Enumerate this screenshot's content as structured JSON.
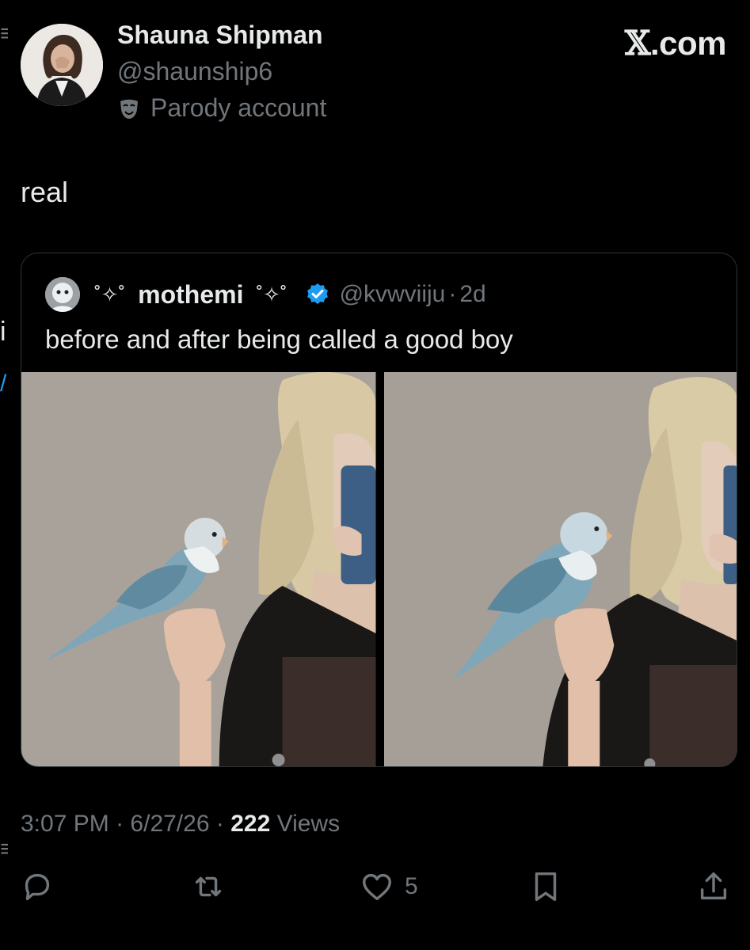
{
  "brand": {
    "x": "𝕏",
    "domain": ".com"
  },
  "author": {
    "display_name": "Shauna Shipman",
    "handle": "@shaunship6",
    "label": "Parody account"
  },
  "tweet": {
    "text": "real"
  },
  "quote": {
    "display_name": "mothemi",
    "sparkle": "˚✧˚",
    "handle": "@kvwviiju",
    "separator": "·",
    "age": "2d",
    "text": "before and after being called a good boy"
  },
  "meta": {
    "time": "3:07 PM",
    "date": "6/27/26",
    "views_count": "222",
    "views_label": "Views",
    "separator": "·"
  },
  "actions": {
    "likes": "5"
  },
  "colors": {
    "background": "#000000",
    "text_primary": "#e7e9ea",
    "text_secondary": "#71767b",
    "border": "#2f3336",
    "verified": "#1d9bf0"
  },
  "icons": [
    "reply-icon",
    "repost-icon",
    "like-icon",
    "bookmark-icon",
    "share-icon",
    "verified-badge-icon",
    "parody-mask-icon"
  ]
}
